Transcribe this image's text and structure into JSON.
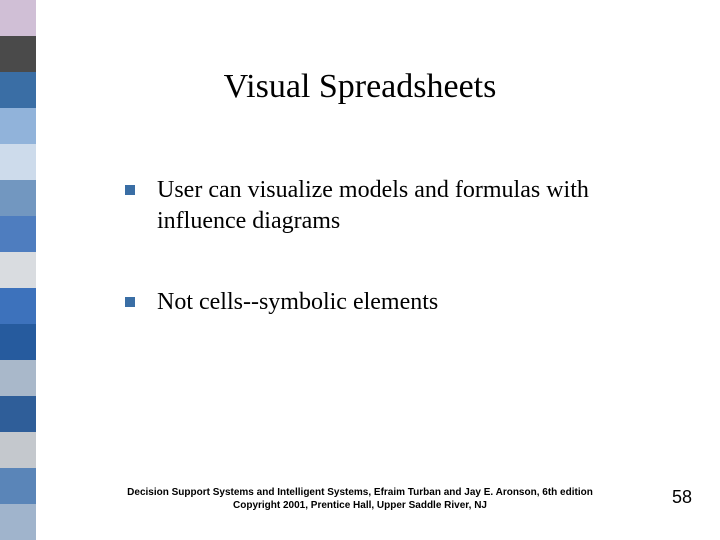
{
  "title": "Visual Spreadsheets",
  "bullets": [
    "User can visualize models and formulas with influence diagrams",
    "Not cells--symbolic elements"
  ],
  "footer": {
    "line1": "Decision Support Systems and Intelligent Systems, Efraim Turban and Jay E. Aronson, 6th edition",
    "line2": "Copyright 2001, Prentice Hall, Upper Saddle River, NJ"
  },
  "page_number": "58"
}
